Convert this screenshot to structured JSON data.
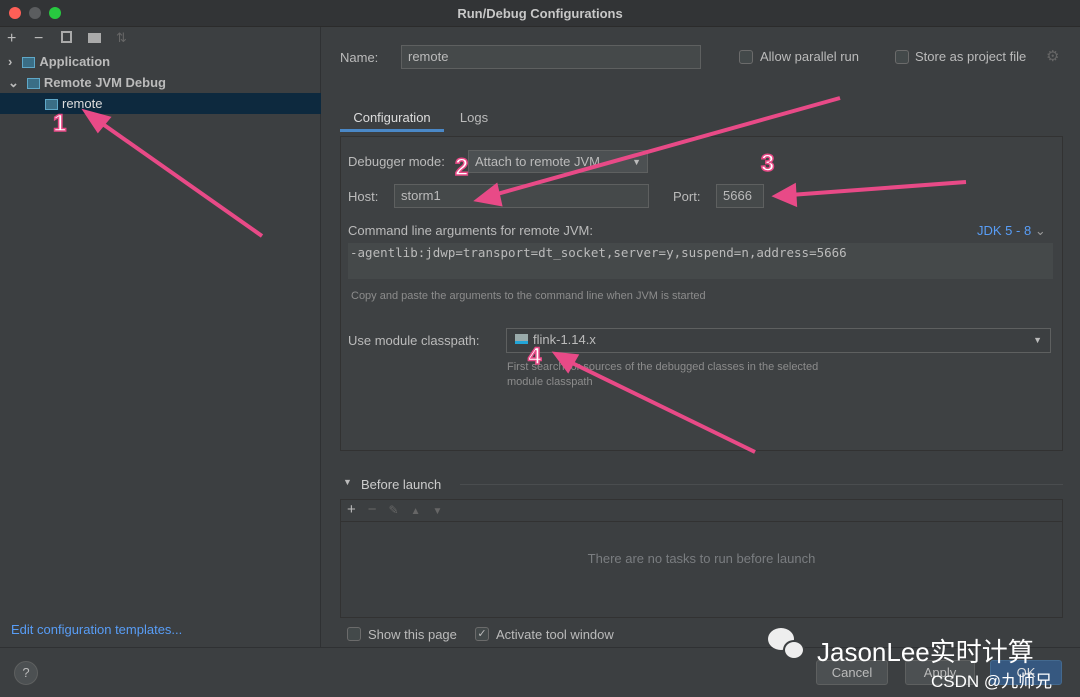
{
  "window": {
    "title": "Run/Debug Configurations"
  },
  "toolbar": {
    "add": "+",
    "remove": "−"
  },
  "tree": [
    {
      "label": "Application"
    },
    {
      "label": "Remote JVM Debug"
    },
    {
      "label": "remote"
    }
  ],
  "edit_templates": "Edit configuration templates...",
  "name": {
    "label": "Name:",
    "value": "remote"
  },
  "allow_parallel": "Allow parallel run",
  "store_project": "Store as project file",
  "tabs": [
    "Configuration",
    "Logs"
  ],
  "debugger_mode": {
    "label": "Debugger mode:",
    "value": "Attach to remote JVM"
  },
  "host": {
    "label": "Host:",
    "value": "storm1"
  },
  "port": {
    "label": "Port:",
    "value": "5666"
  },
  "cmd": {
    "label": "Command line arguments for remote JVM:",
    "jdk": "JDK 5 - 8",
    "value": "-agentlib:jdwp=transport=dt_socket,server=y,suspend=n,address=5666",
    "hint": "Copy and paste the arguments to the command line when JVM is started"
  },
  "classpath": {
    "label": "Use module classpath:",
    "value": "flink-1.14.x",
    "hint1": "First search for sources of the debugged classes in the selected",
    "hint2": "module classpath"
  },
  "before_launch": {
    "title": "Before launch",
    "empty": "There are no tasks to run before launch"
  },
  "show_page": "Show this page",
  "activate_tool": "Activate tool window",
  "buttons": {
    "help": "?",
    "cancel": "Cancel",
    "apply": "Apply",
    "ok": "OK"
  },
  "annotations": [
    "1",
    "2",
    "3",
    "4"
  ],
  "watermarks": {
    "wechat": "JasonLee实时计算",
    "csdn": "CSDN @九师兄"
  },
  "colors": {
    "accent": "#589df6",
    "selection": "#0d293e",
    "ok": "#365880",
    "annotation": "#e84a87"
  }
}
